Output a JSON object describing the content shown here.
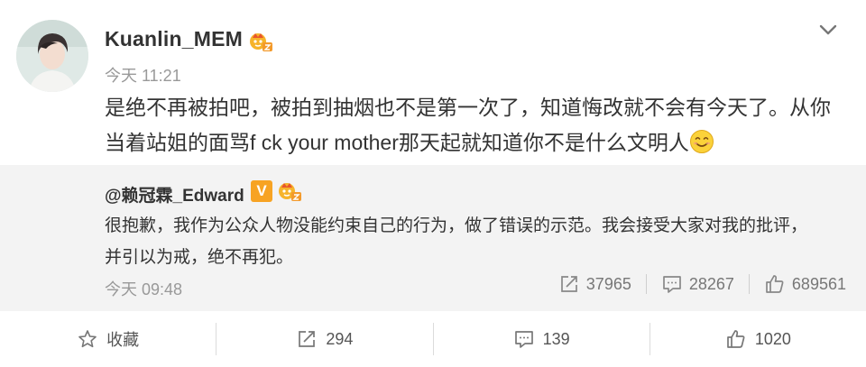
{
  "post": {
    "author": "Kuanlin_MEM",
    "timestamp": "今天 11:21",
    "content_lines": [
      "是绝不再被拍吧，被拍到抽烟也不是第一次了，知道悔改就不会有今天了。从你",
      "当着站姐的面骂f ck your mother那天起就知道你不是什么文明人"
    ],
    "icons": {
      "menu": "chevron-down-icon",
      "badge": "crown-badge-icon",
      "emoji": "smiley-emoji-icon"
    }
  },
  "repost": {
    "author": "@赖冠霖_Edward",
    "verified_mark": "V",
    "content_lines": [
      "很抱歉，我作为公众人物没能约束自己的行为，做了错误的示范。我会接受大家对我的批评，",
      "并引以为戒，绝不再犯。"
    ],
    "timestamp": "今天 09:48",
    "stats": {
      "reposts": "37965",
      "comments": "28267",
      "likes": "689561"
    }
  },
  "actions": {
    "favorite_label": "收藏",
    "repost_count": "294",
    "comment_count": "139",
    "like_count": "1020"
  },
  "colors": {
    "repost_bg": "#f3f3f3",
    "verified": "#f7a323",
    "muted_text": "#999999"
  }
}
